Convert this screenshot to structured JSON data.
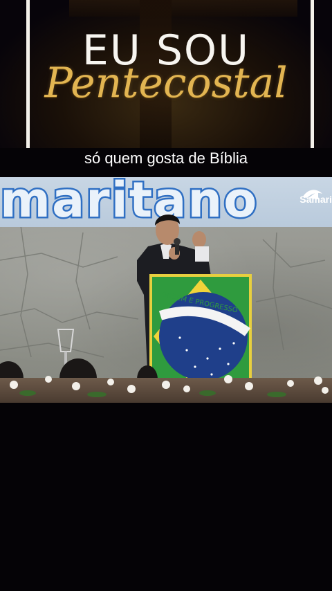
{
  "banner": {
    "title_line1": "EU SOU",
    "title_line2": "Pentecostal"
  },
  "caption": "só quem gosta de Bíblia",
  "video": {
    "sign_text": "maritano",
    "logo_text": "Samari",
    "flag_motto": "ORDEM E PROGRESSO"
  },
  "colors": {
    "title_white": "#f7f5f0",
    "title_gold": "#e2b552",
    "sign_blue": "#2f6fc3",
    "flag_green": "#2f9b3e",
    "flag_yellow": "#f1d33a",
    "flag_blue": "#1f3f8a"
  }
}
